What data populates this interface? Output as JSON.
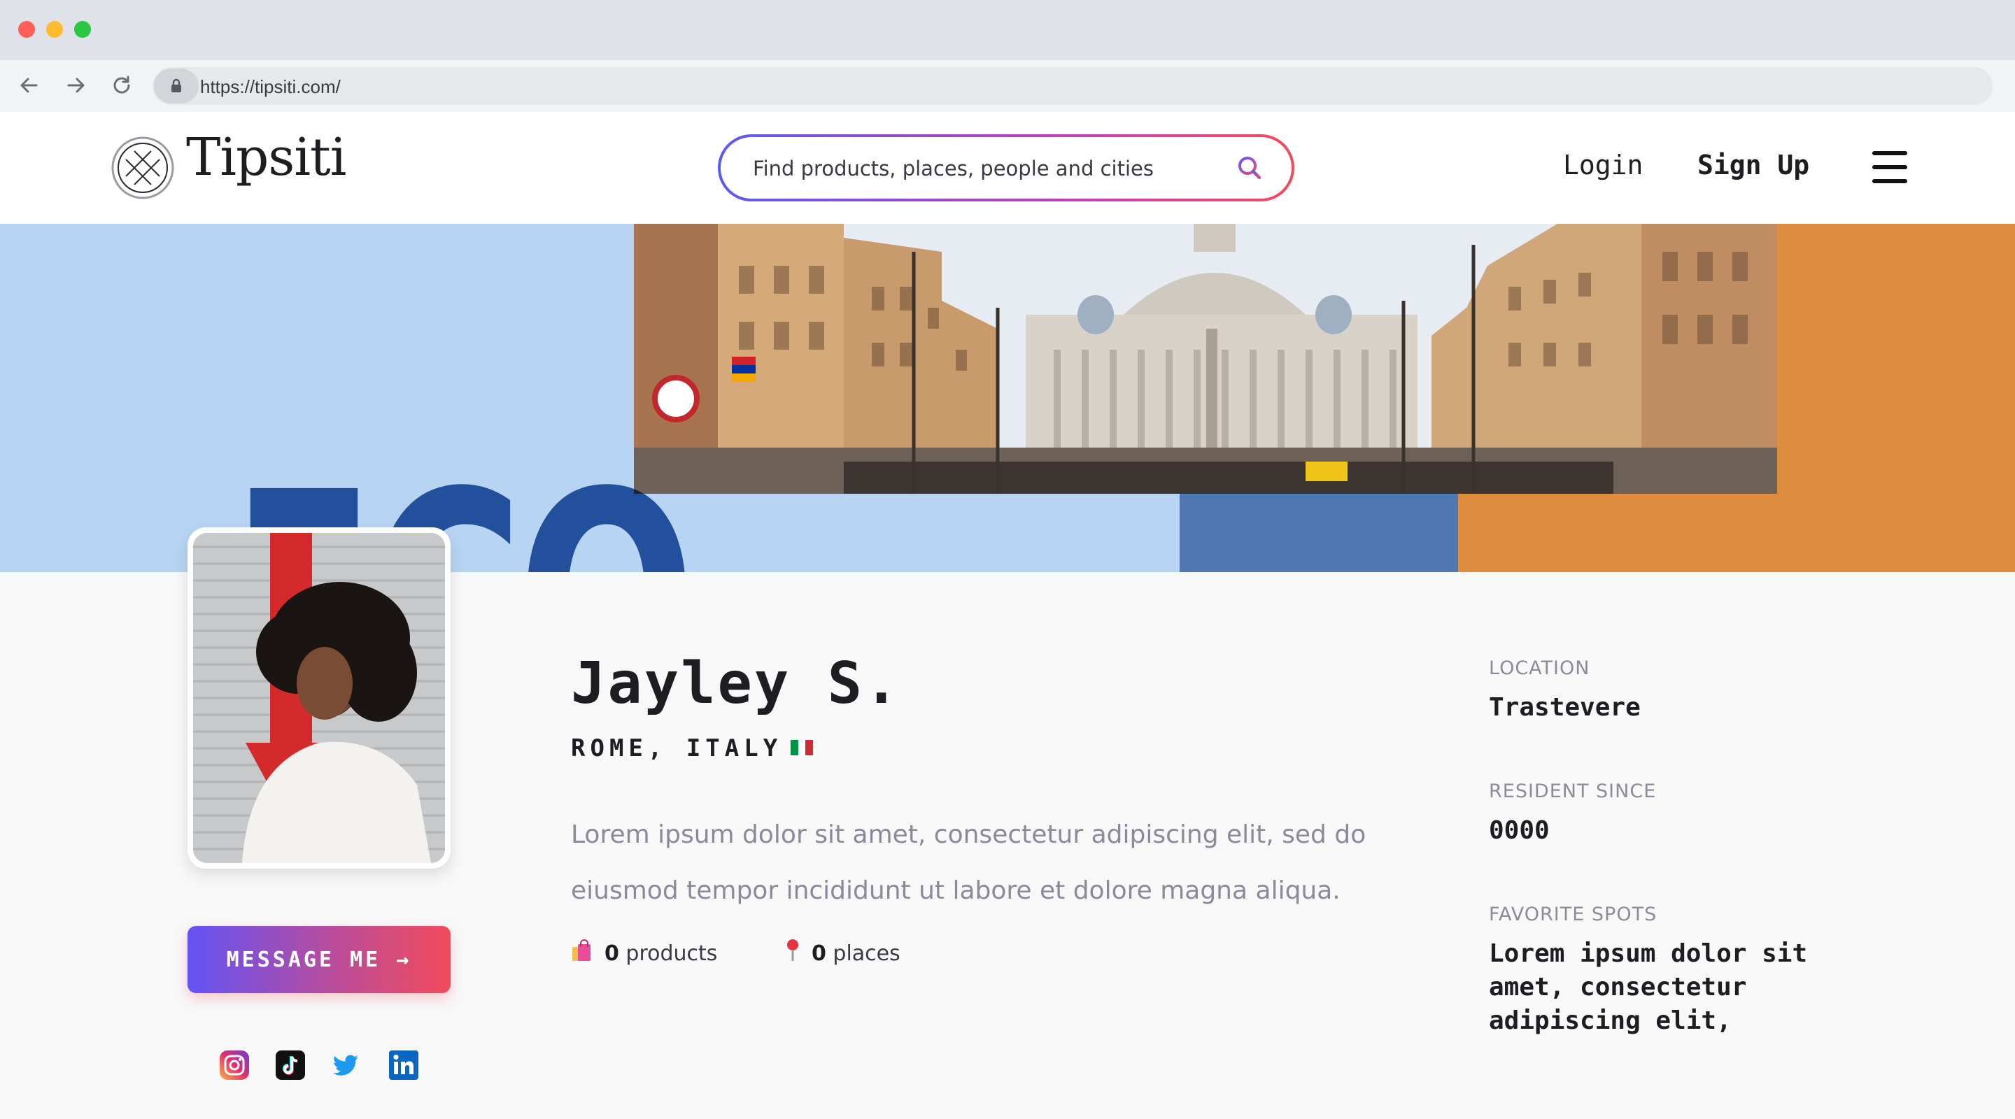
{
  "browser": {
    "url": "https://tipsiti.com/"
  },
  "header": {
    "brand": "Tipsiti",
    "search_placeholder": "Find products, places, people and cities",
    "login_label": "Login",
    "signup_label": "Sign Up"
  },
  "hero": {
    "airport_code": "FCO",
    "colors": {
      "light_blue": "#b7d5f2",
      "blue": "#4f78b3",
      "orange": "#de8d3e",
      "code": "#2f5fa6"
    }
  },
  "profile": {
    "name": "Jayley S.",
    "city": "ROME, ITALY",
    "bio": "Lorem ipsum dolor sit amet, consectetur adipiscing elit, sed do eiusmod tempor incididunt ut labore et dolore magna aliqua.",
    "message_label": "MESSAGE ME →",
    "products_count": "0",
    "products_label": "products",
    "places_count": "0",
    "places_label": "places",
    "socials": [
      "instagram-icon",
      "tiktok-icon",
      "twitter-icon",
      "linkedin-icon"
    ]
  },
  "details": {
    "location_label": "LOCATION",
    "location_value": "Trastevere",
    "resident_label": "RESIDENT SINCE",
    "resident_value": "0000",
    "spots_label": "FAVORITE SPOTS",
    "spots_value": "Lorem ipsum dolor sit amet, consectetur adipiscing elit,"
  }
}
